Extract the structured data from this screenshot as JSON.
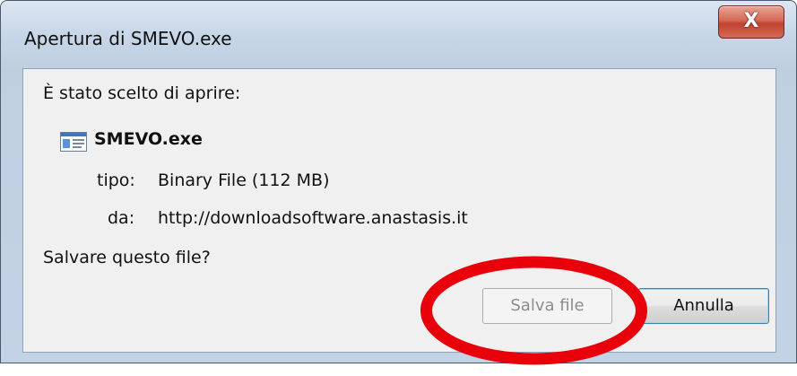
{
  "window": {
    "title": "Apertura di SMEVO.exe",
    "close_glyph": "X"
  },
  "dialog": {
    "prompt": "È stato scelto di aprire:",
    "file_icon": "application-window-icon",
    "file_name": "SMEVO.exe",
    "type_label": "tipo:",
    "type_value": "Binary File (112 MB)",
    "from_label": "da:",
    "from_value": "http://downloadsoftware.anastasis.it",
    "question": "Salvare questo file?"
  },
  "buttons": {
    "save_label": "Salva file",
    "save_enabled": false,
    "cancel_label": "Annulla"
  },
  "annotation": {
    "shape": "ellipse",
    "color": "#e8000b"
  }
}
